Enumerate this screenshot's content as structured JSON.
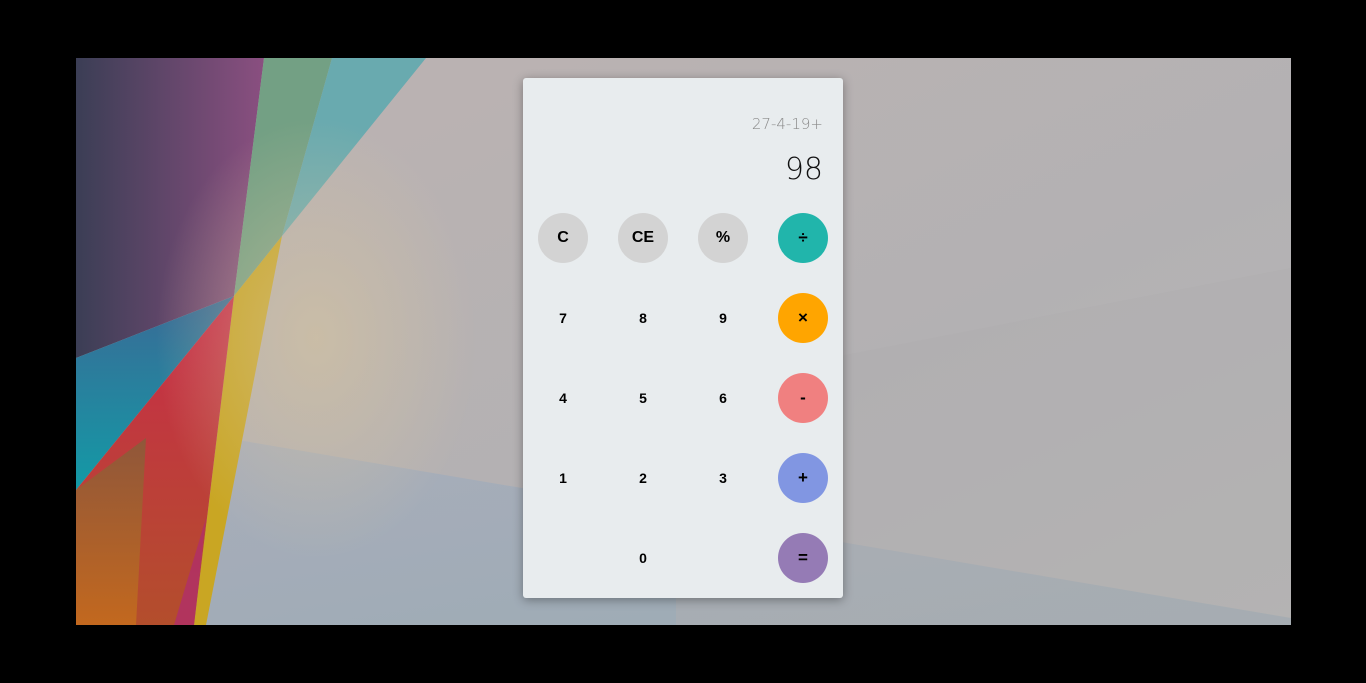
{
  "calculator": {
    "history": "27-4-19+",
    "display": "98",
    "keys": {
      "clear": "C",
      "clear_entry": "CE",
      "percent": "%",
      "divide": "÷",
      "seven": "7",
      "eight": "8",
      "nine": "9",
      "multiply": "×",
      "four": "4",
      "five": "5",
      "six": "6",
      "subtract": "-",
      "one": "1",
      "two": "2",
      "three": "3",
      "add": "+",
      "zero": "0",
      "equals": "="
    }
  },
  "colors": {
    "divide": "#21b5ab",
    "multiply": "#ffa500",
    "subtract": "#f08080",
    "add": "#8196e2",
    "equals": "#957bb5",
    "function_keys": "#d3d3d3",
    "panel": "#e8ecee"
  }
}
